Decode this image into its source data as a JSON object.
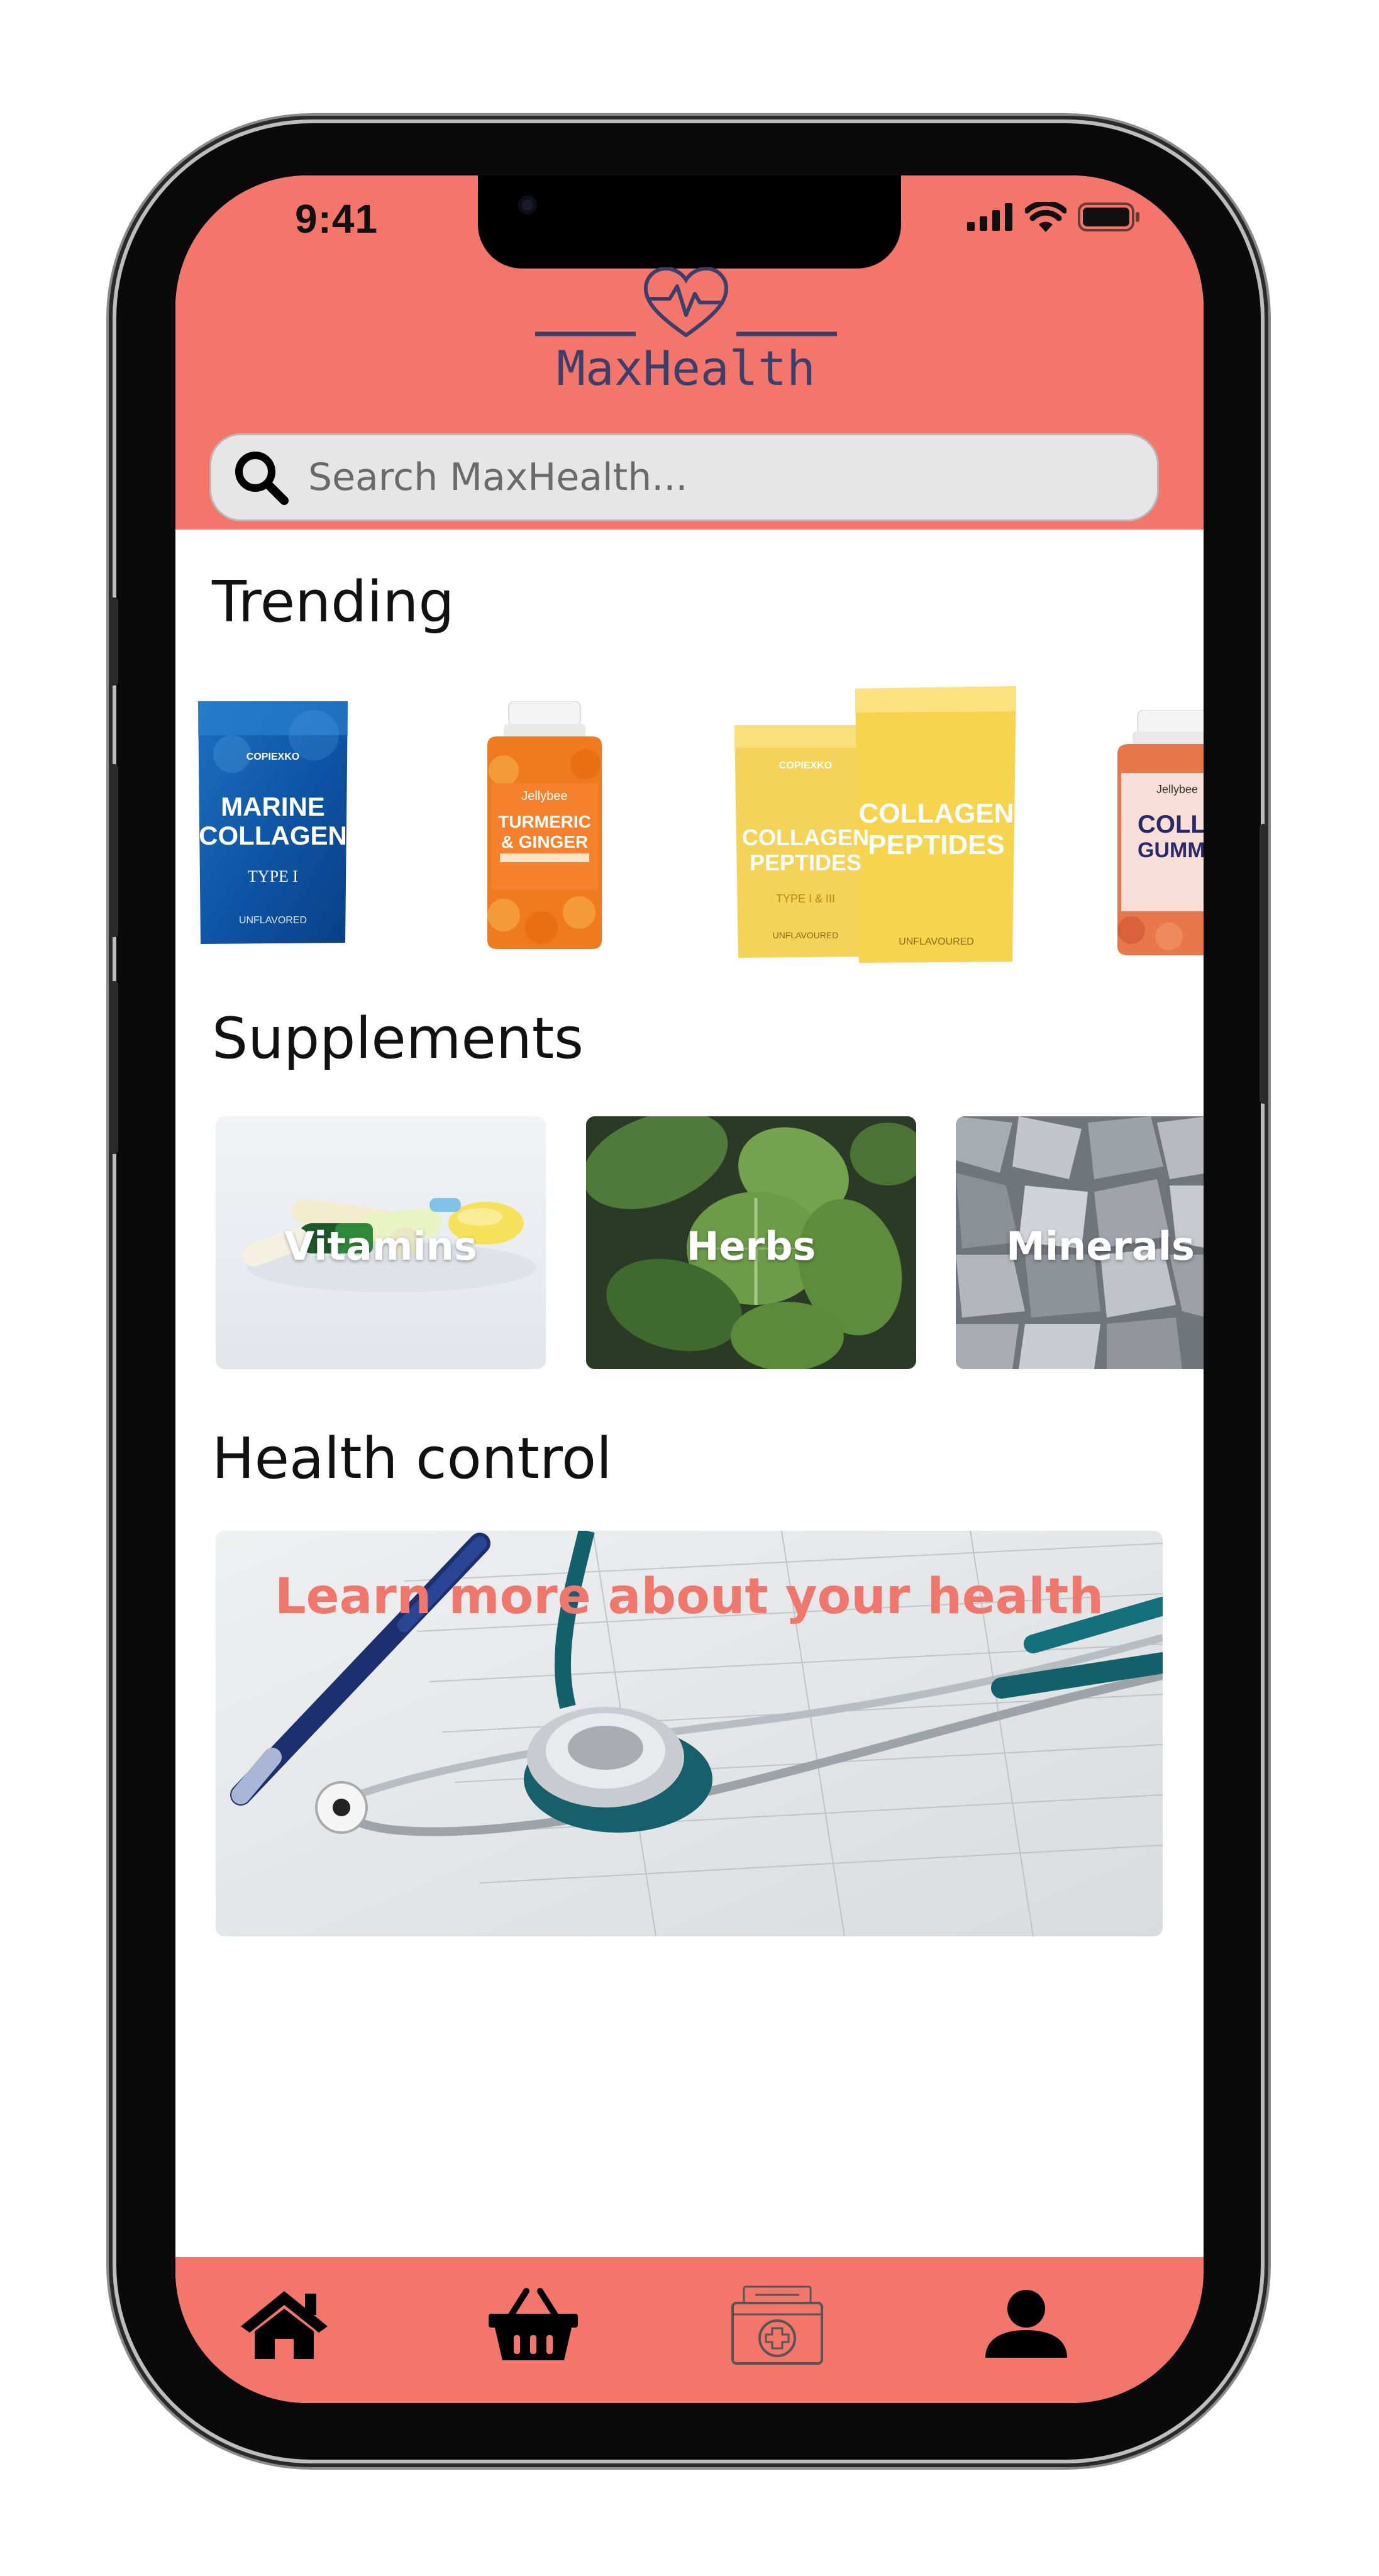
{
  "status_bar": {
    "time": "9:41"
  },
  "brand": {
    "name": "MaxHealth",
    "accent_color": "#f4766a",
    "logo_color": "#3a3f6b"
  },
  "search": {
    "placeholder": "Search MaxHealth..."
  },
  "trending": {
    "title": "Trending",
    "products": [
      {
        "brand": "COPIEXKO",
        "name_line1": "MARINE",
        "name_line2": "COLLAGEN",
        "subtitle": "TYPE I",
        "footer": "UNFLAVORED"
      },
      {
        "brand": "Jellybee",
        "name_line1": "TURMERIC",
        "name_line2": "& GINGER"
      },
      {
        "brand": "COPIEXKO",
        "name_line1": "COLLAGEN",
        "name_line2": "PEPTIDES",
        "subtitle": "TYPE I & III",
        "footer": "UNFLAVOURED"
      },
      {
        "brand": "Jellybee",
        "name_line1": "COLLAG",
        "name_line2": "GUMM"
      }
    ]
  },
  "supplements": {
    "title": "Supplements",
    "categories": [
      {
        "label": "Vitamins"
      },
      {
        "label": "Herbs"
      },
      {
        "label": "Minerals"
      }
    ]
  },
  "health_control": {
    "title": "Health control",
    "banner_text": "Learn more about your health"
  },
  "tab_bar": {
    "items": [
      {
        "icon": "home-icon"
      },
      {
        "icon": "basket-icon"
      },
      {
        "icon": "medical-kit-icon"
      },
      {
        "icon": "user-icon"
      }
    ]
  }
}
